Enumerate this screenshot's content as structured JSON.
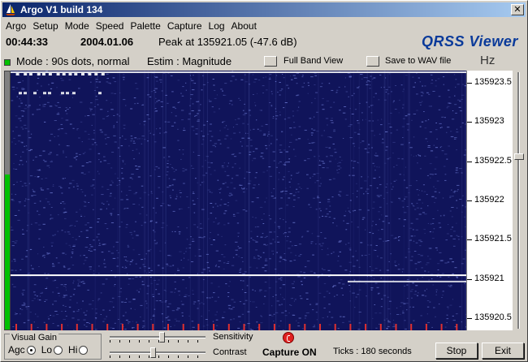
{
  "window": {
    "title": "Argo V1 build 134",
    "close_label": "✕"
  },
  "menu": [
    {
      "label": "Argo"
    },
    {
      "label": "Setup"
    },
    {
      "label": "Mode"
    },
    {
      "label": "Speed"
    },
    {
      "label": "Palette"
    },
    {
      "label": "Capture"
    },
    {
      "label": "Log"
    },
    {
      "label": "About"
    }
  ],
  "status": {
    "time": "00:44:33",
    "date": "2004.01.06",
    "peak": "Peak at 135921.05 (-47.6 dB)",
    "brand": "QRSS Viewer"
  },
  "mode_row": {
    "mode": "Mode : 90s dots, normal",
    "estim": "Estim : Magnitude",
    "full_band_label": "Full Band View",
    "save_wav_label": "Save to WAV file",
    "unit": "Hz"
  },
  "frequency_axis": {
    "labels": [
      "135923.5",
      "135923",
      "135922.5",
      "135922",
      "135921.5",
      "135921",
      "135920.5"
    ],
    "min": 135920.35,
    "max": 135923.65
  },
  "signal_level": 0.6,
  "controls": {
    "visual_gain_title": "Visual Gain",
    "agc_label": "Agc",
    "lo_label": "Lo",
    "hi_label": "Hi",
    "selected": "agc",
    "sensitivity_label": "Sensitivity",
    "contrast_label": "Contrast",
    "sensitivity_value": 0.55,
    "contrast_value": 0.45,
    "capture_label": "Capture ON",
    "ticks_label": "Ticks  :  180 seconds",
    "stop_label": "Stop",
    "exit_label": "Exit"
  },
  "waterfall": {
    "background": "#10145a",
    "noise_color": "#8fa0ff",
    "trace_color": "#ffffff",
    "marker_color": "#e03030",
    "carrier_freq": 135921.05,
    "top_freq": 135923.65,
    "secondary_freq": 135920.98
  }
}
